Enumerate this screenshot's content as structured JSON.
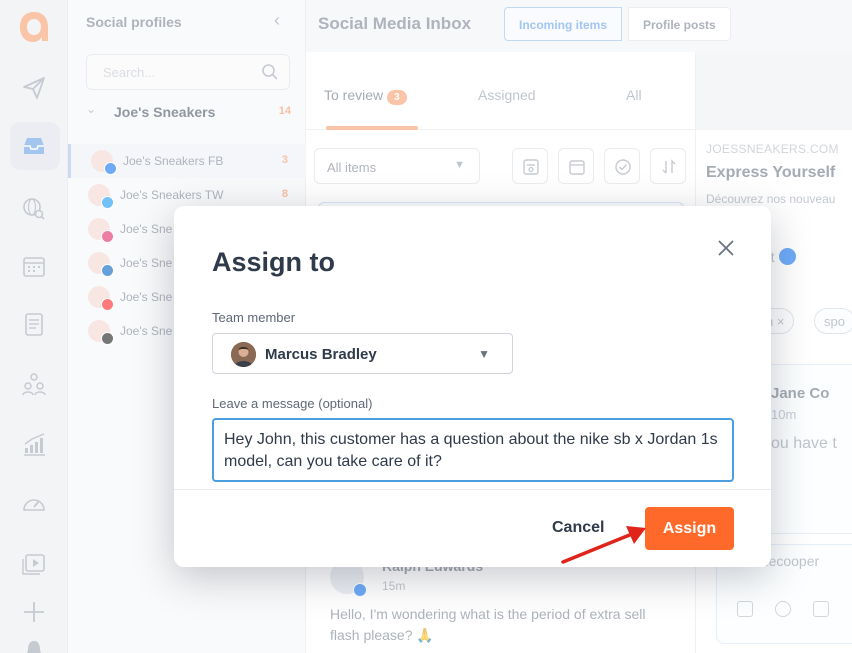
{
  "colors": {
    "accent": "#ff6a2a",
    "focus": "#4b9fe0",
    "badge": "#f7a071",
    "facebook": "#1877f2",
    "annotation_arrow": "#e0231b"
  },
  "sidebar": {
    "title": "Social profiles",
    "search_placeholder": "Search...",
    "group": {
      "name": "Joe's Sneakers",
      "count": "14"
    },
    "profiles": [
      {
        "name": "Joe's Sneakers FB",
        "count": "3",
        "network": "facebook"
      },
      {
        "name": "Joe's Sneakers TW",
        "count": "8",
        "network": "twitter"
      },
      {
        "name": "Joe's Sne",
        "network": "instagram"
      },
      {
        "name": "Joe's Sne",
        "network": "linkedin"
      },
      {
        "name": "Joe's Sne",
        "network": "youtube"
      },
      {
        "name": "Joe's Sne",
        "network": "tiktok"
      }
    ]
  },
  "header": {
    "title": "Social Media Inbox",
    "seg_incoming": "Incoming items",
    "seg_posts": "Profile posts"
  },
  "list": {
    "tabs": [
      {
        "label": "To review",
        "badge": "3"
      },
      {
        "label": "Assigned"
      },
      {
        "label": "All"
      }
    ],
    "filter_value": "All items",
    "message": {
      "author": "Ralph Edwards",
      "time": "15m",
      "text": "Hello, I'm wondering what is the period of extra sell flash please? 🙏"
    }
  },
  "preview": {
    "source": "JOESSNEAKERS.COM",
    "title": "Express Yourself",
    "desc": "Découvrez nos nouveau",
    "post_label": "ost",
    "chips": [
      "n ×",
      "spo"
    ],
    "comment": {
      "author": "Jane Co",
      "time": "10m",
      "text": "ou have t"
    },
    "reply_handle": "anecooper"
  },
  "modal": {
    "title": "Assign to",
    "team_label": "Team member",
    "team_value": "Marcus Bradley",
    "message_label": "Leave a message (optional)",
    "message_value": "Hey John, this customer has a question about the nike sb x Jordan 1s model, can you take care of it?",
    "cancel": "Cancel",
    "assign": "Assign"
  },
  "icons": [
    "logo-icon",
    "send-icon",
    "inbox-icon",
    "globe-search-icon",
    "calendar-icon",
    "notes-icon",
    "team-icon",
    "analytics-icon",
    "gauge-icon",
    "media-icon",
    "add-icon",
    "bell-icon",
    "search-icon",
    "close-icon",
    "chevron-down-icon",
    "collapse-icon"
  ]
}
